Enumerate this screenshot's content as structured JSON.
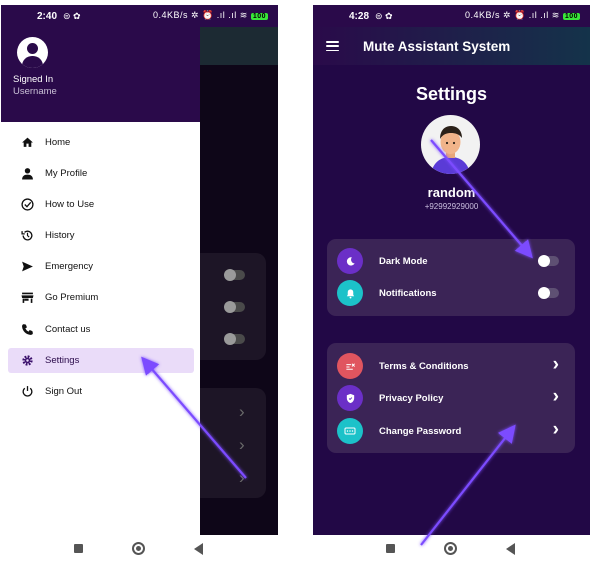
{
  "left_screen": {
    "status": {
      "time": "2:40",
      "right": "0.4KB/s",
      "battery": "100"
    },
    "drawer": {
      "signed_in": "Signed In",
      "username": "Username"
    },
    "menu": [
      {
        "label": "Home",
        "icon": "home-icon"
      },
      {
        "label": "My Profile",
        "icon": "person-icon"
      },
      {
        "label": "How to Use",
        "icon": "check-circle-icon"
      },
      {
        "label": "History",
        "icon": "history-icon"
      },
      {
        "label": "Emergency",
        "icon": "send-icon"
      },
      {
        "label": "Go Premium",
        "icon": "store-icon"
      },
      {
        "label": "Contact us",
        "icon": "phone-icon"
      },
      {
        "label": "Settings",
        "icon": "gear-icon",
        "active": true
      },
      {
        "label": "Sign Out",
        "icon": "power-icon"
      }
    ]
  },
  "right_screen": {
    "status": {
      "time": "4:28",
      "right": "0.4KB/s",
      "battery": "100"
    },
    "app_title": "Mute Assistant System",
    "heading": "Settings",
    "profile": {
      "name": "random",
      "phone": "+92992929000"
    },
    "toggles": [
      {
        "label": "Dark Mode",
        "icon": "moon-icon",
        "icon_color": "#6b2fc7",
        "on": false
      },
      {
        "label": "Notifications",
        "icon": "bell-icon",
        "icon_color": "#1cc2c9",
        "on": false
      }
    ],
    "links": [
      {
        "label": "Terms & Conditions",
        "icon": "terms-icon",
        "icon_color": "#e0555f"
      },
      {
        "label": "Privacy Policy",
        "icon": "shield-icon",
        "icon_color": "#6b2fc7"
      },
      {
        "label": "Change Password",
        "icon": "password-icon",
        "icon_color": "#1cc2c9"
      }
    ]
  },
  "colors": {
    "drawer_header": "#2a0a4a",
    "active_item": "#eadcf9",
    "screen_bg": "#220846",
    "card": "#3b2456",
    "arrow": "#7b4cff"
  }
}
